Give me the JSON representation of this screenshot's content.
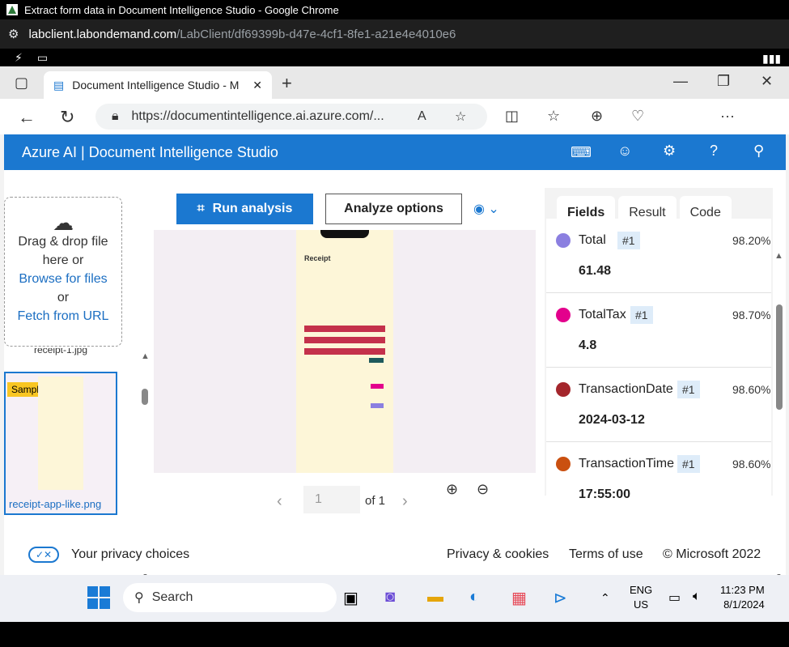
{
  "chrome": {
    "title": "Extract form data in Document Intelligence Studio - Google Chrome",
    "url_host": "labclient.labondemand.com",
    "url_path": "/LabClient/df69399b-d47e-4cf1-8fe1-a21e4e4010e6"
  },
  "edge": {
    "tab_title": "Document Intelligence Studio - M",
    "address": "https://documentintelligence.ai.azure.com/..."
  },
  "azure": {
    "header_title": "Azure AI | Document Intelligence Studio"
  },
  "left": {
    "drop_text_1": "Drag & drop file",
    "drop_text_2": "here or",
    "browse": "Browse for files",
    "or": "or",
    "fetch": "Fetch from URL",
    "prev_file": "receipt-1.jpg",
    "sample_badge": "Sample",
    "file_name": "receipt-app-like.png"
  },
  "center": {
    "run_label": "Run analysis",
    "options_label": "Analyze options",
    "page_value": "1",
    "page_of": "of 1"
  },
  "right": {
    "tabs": [
      "Fields",
      "Result",
      "Code"
    ],
    "fields": [
      {
        "name": "Total",
        "badge": "#1",
        "conf": "98.20%",
        "value": "61.48",
        "color": "#8b7fe0"
      },
      {
        "name": "TotalTax",
        "badge": "#1",
        "conf": "98.70%",
        "value": "4.8",
        "color": "#e3008c"
      },
      {
        "name": "TransactionDate",
        "badge": "#1",
        "conf": "98.60%",
        "value": "2024-03-12",
        "color": "#a4262c"
      },
      {
        "name": "TransactionTime",
        "badge": "#1",
        "conf": "98.60%",
        "value": "17:55:00",
        "color": "#ca5010"
      }
    ]
  },
  "footer": {
    "privacy_choices": "Your privacy choices",
    "privacy_cookies": "Privacy & cookies",
    "terms": "Terms of use",
    "copyright": "© Microsoft 2022"
  },
  "taskbar": {
    "search": "Search",
    "lang1": "ENG",
    "lang2": "US",
    "time": "11:23 PM",
    "date": "8/1/2024"
  }
}
